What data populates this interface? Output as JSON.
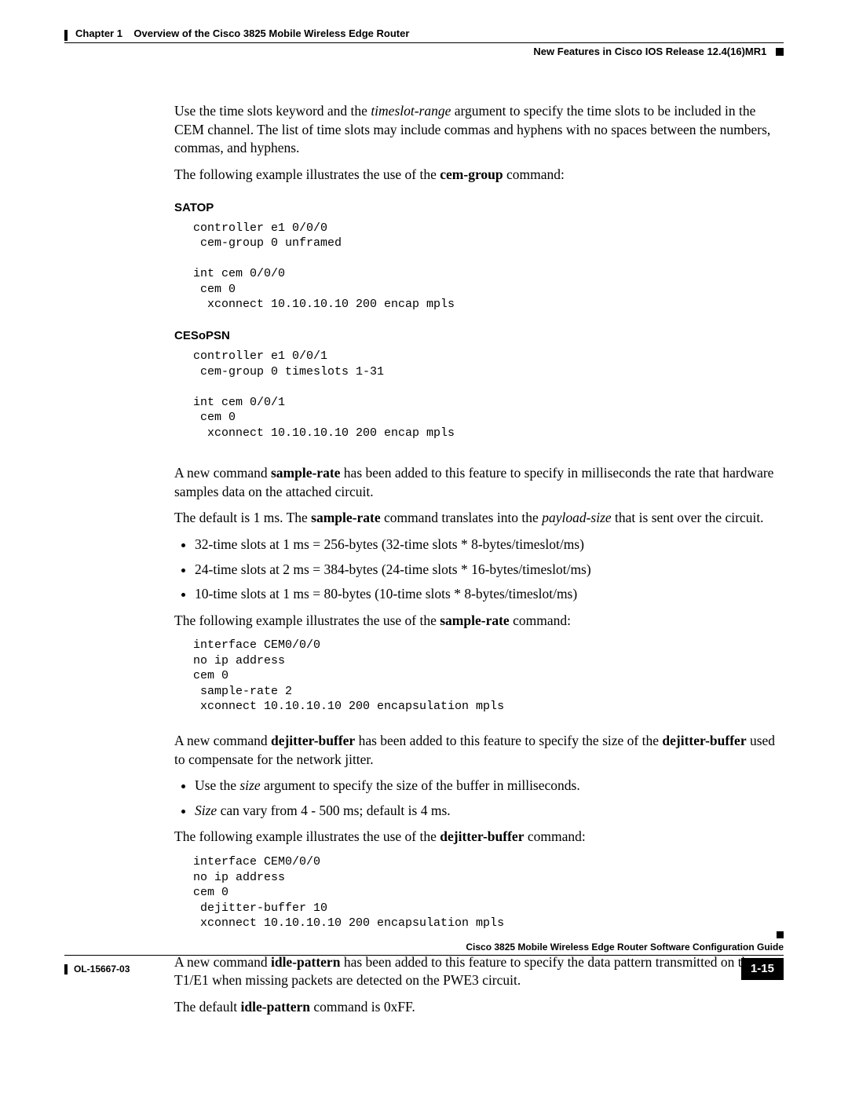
{
  "header": {
    "chapter_label": "Chapter 1",
    "chapter_title": "Overview of the Cisco 3825 Mobile Wireless Edge Router",
    "section_title": "New Features in Cisco IOS Release 12.4(16)MR1"
  },
  "body": {
    "p1a": "Use the time slots keyword and the ",
    "p1b": "timeslot-range",
    "p1c": " argument to specify the time slots to be included in the CEM channel. The list of time slots may include commas and hyphens with no spaces between the numbers, commas, and hyphens.",
    "p2a": "The following example illustrates the use of the ",
    "p2b": "cem-group",
    "p2c": " command:",
    "h_satop": "SATOP",
    "code_satop": "controller e1 0/0/0\n cem-group 0 unframed\n\nint cem 0/0/0\n cem 0\n  xconnect 10.10.10.10 200 encap mpls",
    "h_ces": "CESoPSN",
    "code_ces": "controller e1 0/0/1\n cem-group 0 timeslots 1-31\n\nint cem 0/0/1\n cem 0\n  xconnect 10.10.10.10 200 encap mpls",
    "p3a": "A new command ",
    "p3b": "sample-rate",
    "p3c": " has been added to this feature to specify in milliseconds the rate that hardware samples data on the attached circuit.",
    "p4a": "The default is 1 ms. The ",
    "p4b": "sample-rate",
    "p4c": " command translates into the ",
    "p4d": "payload-size",
    "p4e": " that is sent over the circuit.",
    "bullets1": [
      "32-time slots at 1 ms = 256-bytes (32-time slots * 8-bytes/timeslot/ms)",
      "24-time slots at 2 ms = 384-bytes (24-time slots * 16-bytes/timeslot/ms)",
      "10-time slots at 1 ms = 80-bytes (10-time slots * 8-bytes/timeslot/ms)"
    ],
    "p5a": "The following example illustrates the use of the ",
    "p5b": "sample-rate",
    "p5c": " command:",
    "code_sample": "interface CEM0/0/0\nno ip address\ncem 0\n sample-rate 2\n xconnect 10.10.10.10 200 encapsulation mpls",
    "p6a": "A new command ",
    "p6b": "dejitter-buffer",
    "p6c": " has been added to this feature to specify the size of the ",
    "p6d": "dejitter-buffer",
    "p6e": " used to compensate for the network jitter.",
    "bullets2": {
      "b1a": "Use the ",
      "b1b": "size",
      "b1c": " argument to specify the size of the buffer in milliseconds.",
      "b2a": "Size",
      "b2b": " can vary from 4 - 500 ms; default is 4 ms."
    },
    "p7a": "The following example illustrates the use of the ",
    "p7b": "dejitter-buffer",
    "p7c": " command:",
    "code_dejitter": "interface CEM0/0/0\nno ip address\ncem 0\n dejitter-buffer 10\n xconnect 10.10.10.10 200 encapsulation mpls",
    "p8a": "A new command ",
    "p8b": "idle-pattern",
    "p8c": " has been added to this feature to specify the data pattern transmitted on the T1/E1 when missing packets are detected on the PWE3 circuit.",
    "p9a": "The default ",
    "p9b": "idle-pattern",
    "p9c": " command is 0xFF."
  },
  "footer": {
    "book_title": "Cisco 3825 Mobile Wireless Edge Router Software Configuration Guide",
    "doc_id": "OL-15667-03",
    "page_num": "1-15"
  }
}
